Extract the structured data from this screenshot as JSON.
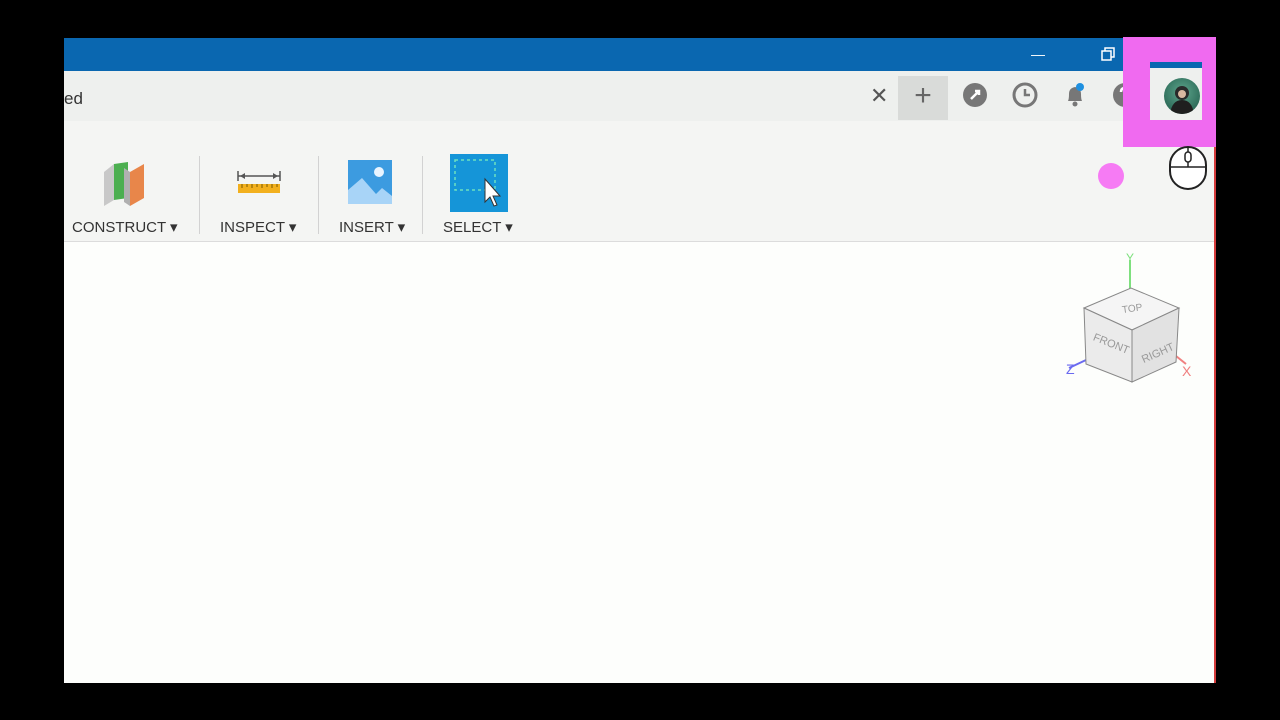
{
  "tab": {
    "title": "ed"
  },
  "toolbar": {
    "construct_label": "CONSTRUCT",
    "inspect_label": "INSPECT",
    "insert_label": "INSERT",
    "select_label": "SELECT"
  },
  "viewcube": {
    "top": "TOP",
    "front": "FRONT",
    "right": "RIGHT",
    "axis_x": "X",
    "axis_y": "Y",
    "axis_z": "Z"
  },
  "colors": {
    "titlebar": "#0a67b0",
    "highlight": "#f06af0",
    "select_tile": "#1595d8"
  },
  "icons": [
    "minimize-icon",
    "restore-icon",
    "close-tab-icon",
    "plus-icon",
    "extensions-icon",
    "history-icon",
    "notifications-icon",
    "help-icon",
    "user-avatar",
    "mouse-icon"
  ]
}
